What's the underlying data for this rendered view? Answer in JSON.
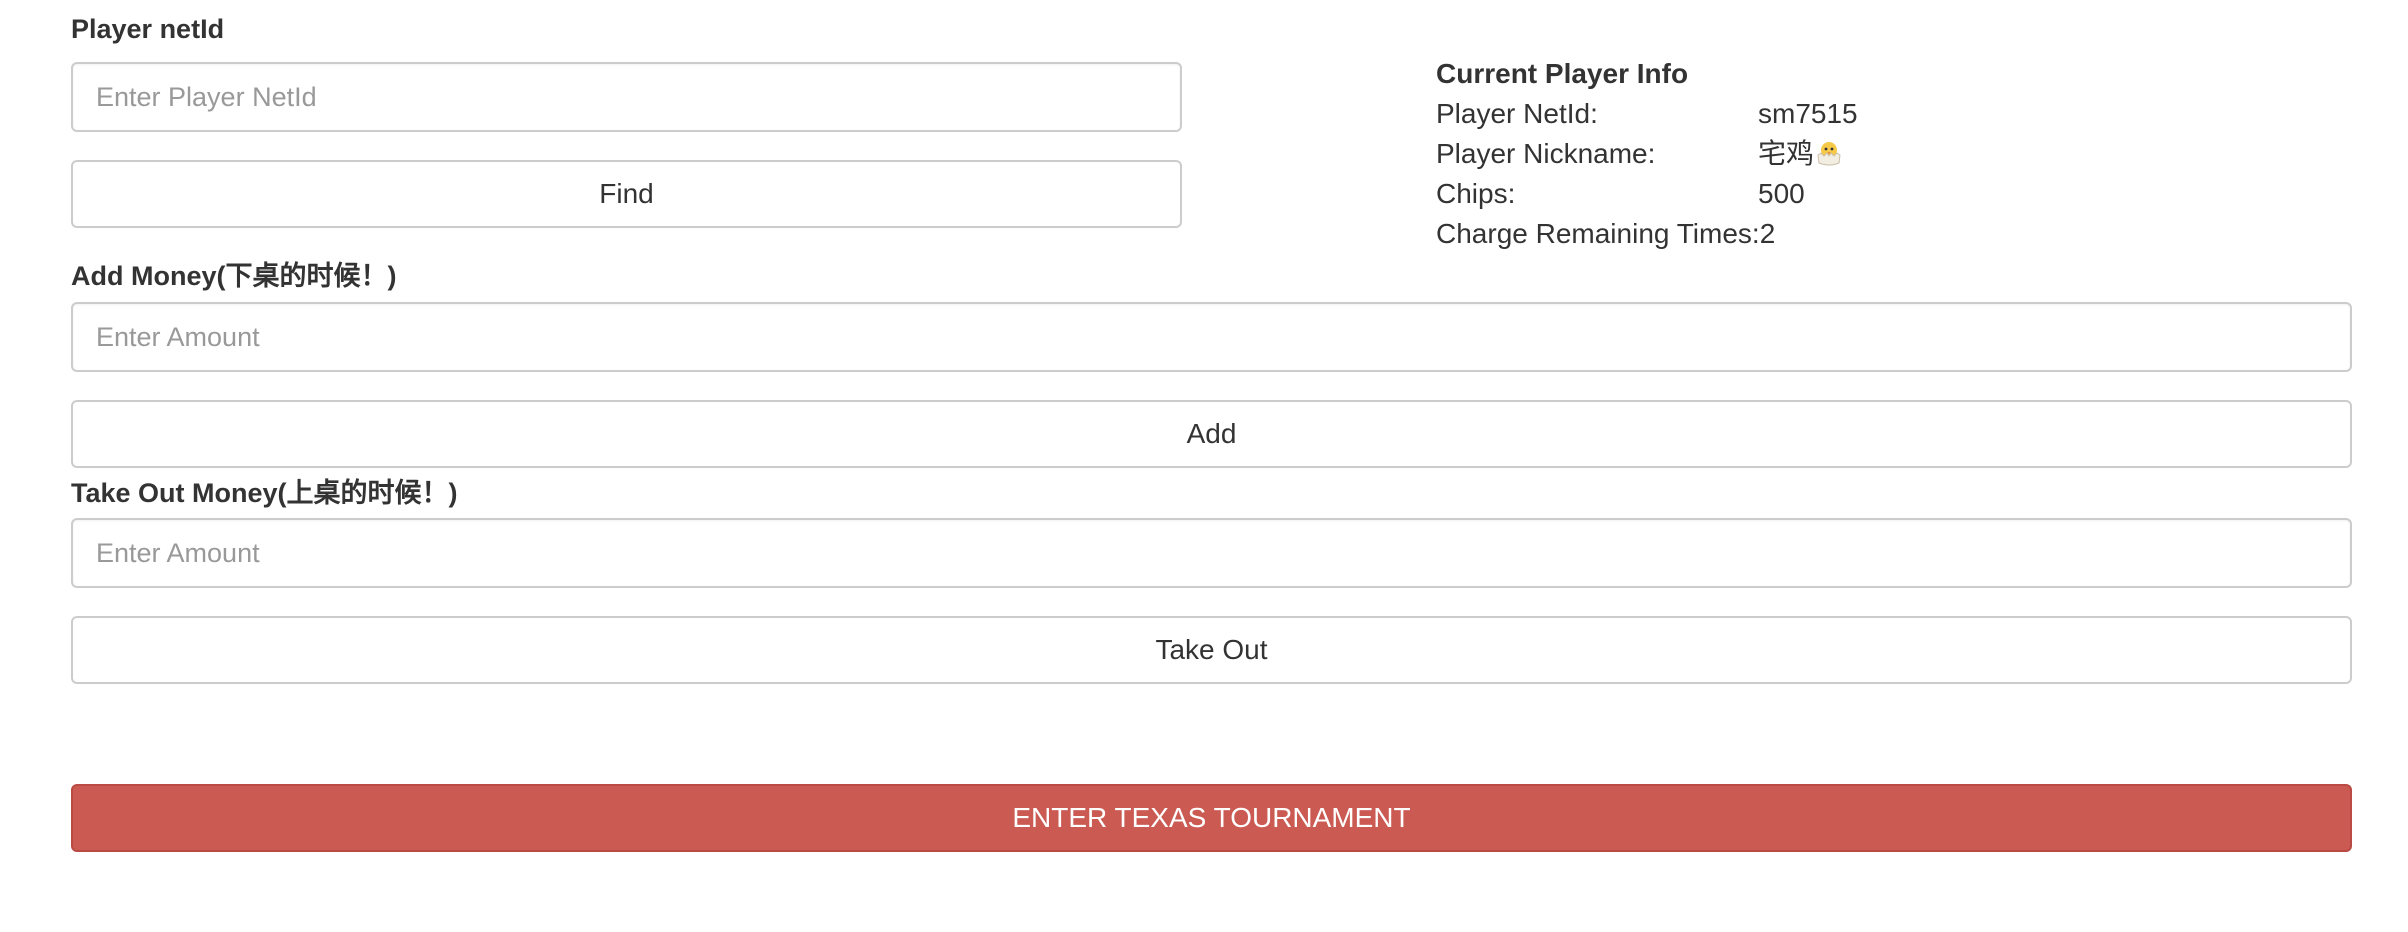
{
  "find_section": {
    "label": "Player netId",
    "input_placeholder": "Enter Player NetId",
    "button_label": "Find"
  },
  "player_info": {
    "title": "Current Player Info",
    "netid_key": "Player NetId:",
    "netid_value": "sm7515",
    "nickname_key": "Player Nickname:",
    "nickname_value": "宅鸡",
    "nickname_icon": "hatching-chick-icon",
    "chips_key": "Chips:",
    "chips_value": "500",
    "charge_key": "Charge Remaining Times:",
    "charge_value": "2"
  },
  "add_money": {
    "label": "Add Money(下桌的时候！)",
    "input_placeholder": "Enter Amount",
    "button_label": "Add"
  },
  "take_out_money": {
    "label": "Take Out Money(上桌的时候！)",
    "input_placeholder": "Enter Amount",
    "button_label": "Take Out"
  },
  "tournament": {
    "button_label": "ENTER TEXAS TOURNAMENT",
    "button_color": "#cb5a53"
  }
}
